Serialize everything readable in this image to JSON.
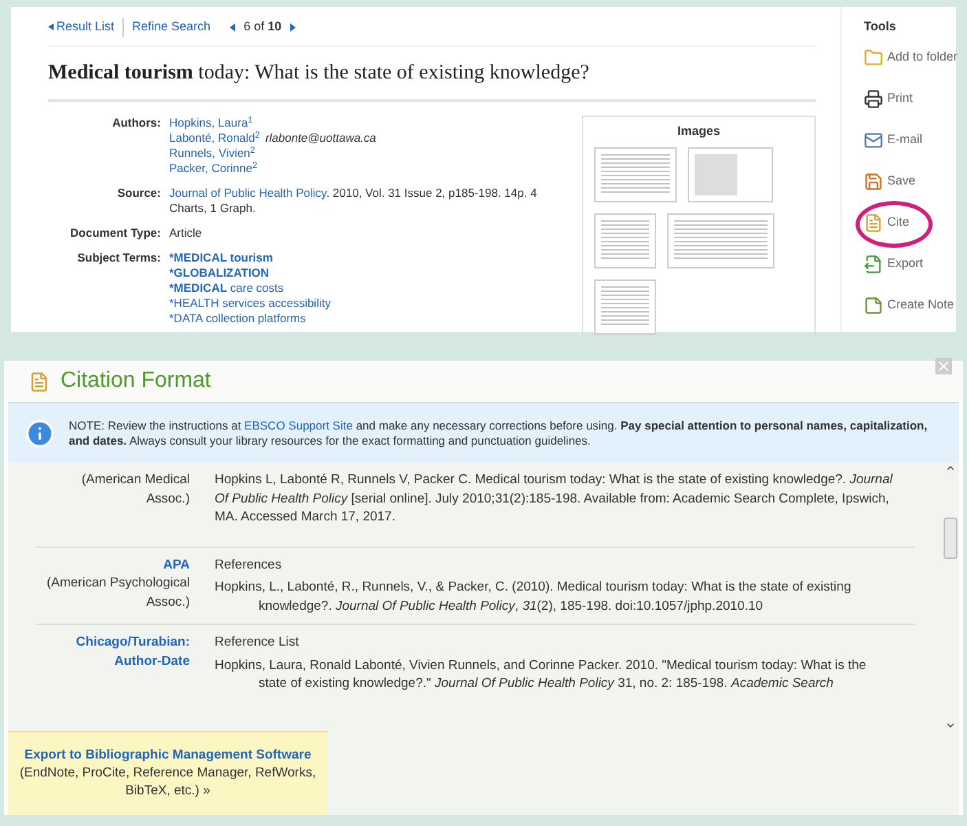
{
  "record": {
    "nav": {
      "result_list": "Result List",
      "refine_search": "Refine Search",
      "position": "6 of ",
      "total": "10"
    },
    "title": "**Medical tourism** today: What is the state of existing knowledge?",
    "fields": [
      {
        "kind": "authors",
        "label": "Authors:",
        "authors": [
          {
            "name": "Hopkins, Laura$^{1}$"
          },
          {
            "name": "Labonté, Ronald$^{2}$",
            "email": "rlabonte@uottawa.ca"
          },
          {
            "name": "Runnels, Vivien$^{2}$"
          },
          {
            "name": "Packer, Corinne$^{2}$"
          }
        ]
      },
      {
        "kind": "source",
        "label": "Source:",
        "link": "Journal of Public Health Policy",
        "text": ". 2010, Vol. 31 Issue 2, p185-198. 14p. 4 Charts, 1 Graph."
      },
      {
        "kind": "plain",
        "label": "Document Type:",
        "text": "Article"
      },
      {
        "kind": "terms",
        "label": "Subject Terms:",
        "terms": [
          {
            "bold": "*MEDICAL tourism"
          },
          {
            "bold": "*GLOBALIZATION"
          },
          {
            "bold": "*MEDICAL",
            "text": " care costs"
          },
          {
            "text": "*HEALTH services accessibility"
          },
          {
            "text": "*DATA collection platforms"
          }
        ]
      }
    ],
    "images": {
      "title": "Images"
    }
  },
  "tools": {
    "title": "Tools",
    "items": [
      {
        "kind": "folder",
        "label": "Add to folder",
        "highlighted": false
      },
      {
        "kind": "print",
        "label": "Print",
        "highlighted": false
      },
      {
        "kind": "email",
        "label": "E-mail",
        "highlighted": false
      },
      {
        "kind": "save",
        "label": "Save",
        "highlighted": false
      },
      {
        "kind": "cite",
        "label": "Cite",
        "highlighted": true
      },
      {
        "kind": "export",
        "label": "Export",
        "highlighted": false
      },
      {
        "kind": "note",
        "label": "Create Note",
        "highlighted": false
      }
    ]
  },
  "citation_dialog": {
    "title": "Citation Format",
    "note": {
      "before": "NOTE: Review the instructions at ",
      "link": "EBSCO Support Site",
      "after": " and make any necessary corrections before using. **Pay special attention to personal names, capitalization, and dates.** Always consult your library resources for the exact formatting and punctuation guidelines."
    },
    "entries": [
      {
        "description": "(American Medical Assoc.)",
        "lines": [
          "Hopkins L, Labonté R, Runnels V, Packer C. Medical tourism today: What is the state of existing knowledge?. *Journal Of Public Health Policy* [serial online]. July 2010;31(2):185-198. Available from: Academic Search Complete, Ipswich, MA. Accessed March 17, 2017."
        ]
      },
      {
        "style": "APA",
        "description": "(American Psychological Assoc.)",
        "heading": "References",
        "lines": [
          "Hopkins, L., Labonté, R., Runnels, V., & Packer, C. (2010). Medical tourism today: What is the state of existing knowledge?. *Journal Of Public Health Policy*, *31*(2), 185-198. doi:10.1057/jphp.2010.10"
        ]
      },
      {
        "style": "Chicago/Turabian: Author-Date",
        "heading": "Reference List",
        "lines": [
          "Hopkins, Laura, Ronald Labonté, Vivien Runnels, and Corinne Packer. 2010. \"Medical tourism today: What is the state of existing knowledge?.\" *Journal Of Public Health Policy* 31, no. 2: 185-198. *Academic Search*"
        ]
      }
    ],
    "export": {
      "link": "Export to Bibliographic Management Software",
      "text": "(EndNote, ProCite, Reference Manager, RefWorks, BibTeX, etc.) »"
    }
  }
}
